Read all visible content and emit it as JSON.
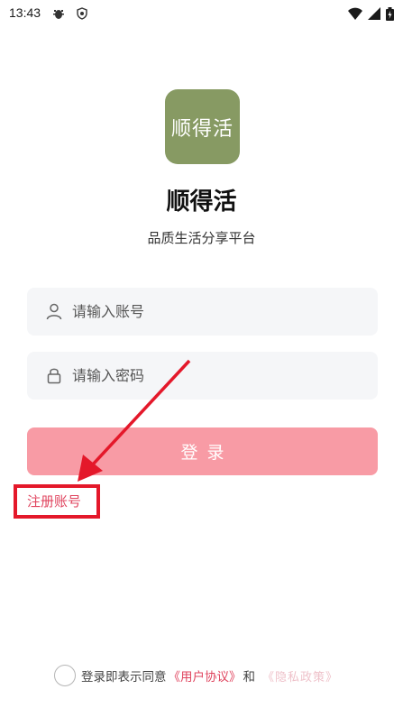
{
  "status_bar": {
    "time": "13:43",
    "left_icons": [
      "bug-icon",
      "shield-icon"
    ],
    "right_icons": [
      "wifi-icon",
      "signal-icon",
      "battery-icon"
    ]
  },
  "app": {
    "logo_text": "顺得活",
    "name": "顺得活",
    "slogan": "品质生活分享平台",
    "logo_color": "#879a63"
  },
  "form": {
    "account_placeholder": "请输入账号",
    "account_value": "",
    "password_placeholder": "请输入密码",
    "password_value": "",
    "login_label": "登录",
    "register_label": "注册账号"
  },
  "agreement": {
    "prefix": "登录即表示同意",
    "user_agreement": "《用户协议》",
    "conjunction": "和",
    "privacy_policy": "《隐私政策》",
    "checked": false
  },
  "colors": {
    "login_button": "#f89ba5",
    "link": "#e0455f",
    "annotation": "#e4182a"
  }
}
